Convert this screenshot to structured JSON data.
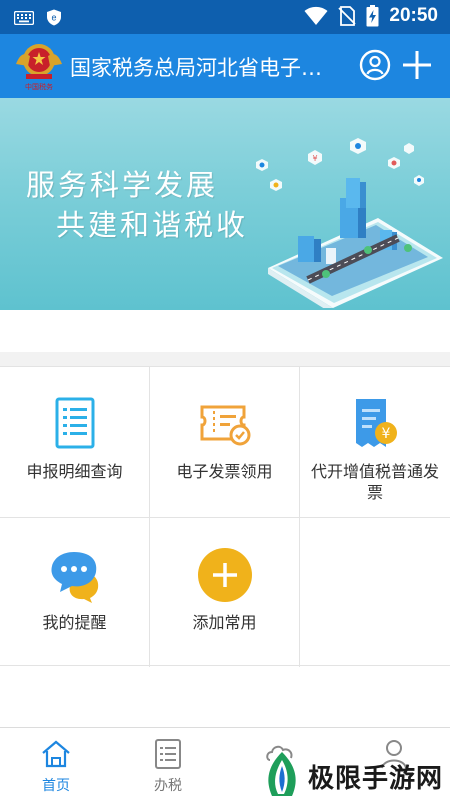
{
  "status_bar": {
    "time": "20:50",
    "icons": [
      "keyboard-icon",
      "vpn-shield-icon",
      "wifi-icon",
      "no-sim-icon",
      "battery-charging-icon"
    ]
  },
  "app_bar": {
    "title": "国家税务总局河北省电子税务局",
    "logo_icon": "tax-emblem-icon",
    "actions": [
      "user-icon",
      "add-icon"
    ]
  },
  "banner": {
    "line1": "服务科学发展",
    "line2": "共建和谐税收"
  },
  "grid": {
    "items": [
      {
        "label": "申报明细查询",
        "icon": "document-list-icon"
      },
      {
        "label": "电子发票领用",
        "icon": "invoice-ticket-icon"
      },
      {
        "label": "代开增值税普通发票",
        "icon": "yuan-invoice-icon"
      },
      {
        "label": "我的提醒",
        "icon": "chat-bubble-icon"
      },
      {
        "label": "添加常用",
        "icon": "add-circle-icon"
      }
    ]
  },
  "bottom_nav": {
    "items": [
      {
        "label": "首页",
        "icon": "home-icon",
        "active": true
      },
      {
        "label": "办税",
        "icon": "list-doc-icon",
        "active": false
      },
      {
        "label": "",
        "icon": "cloud-icon",
        "active": false
      },
      {
        "label": "",
        "icon": "profile-icon",
        "active": false
      }
    ]
  },
  "watermark": {
    "text": "极限手游网"
  },
  "colors": {
    "status_bar": "#0e5fae",
    "app_bar": "#1d86e0",
    "banner": "#7ecfd9",
    "accent_active": "#1d86e0",
    "add_circle": "#f0b21b"
  }
}
